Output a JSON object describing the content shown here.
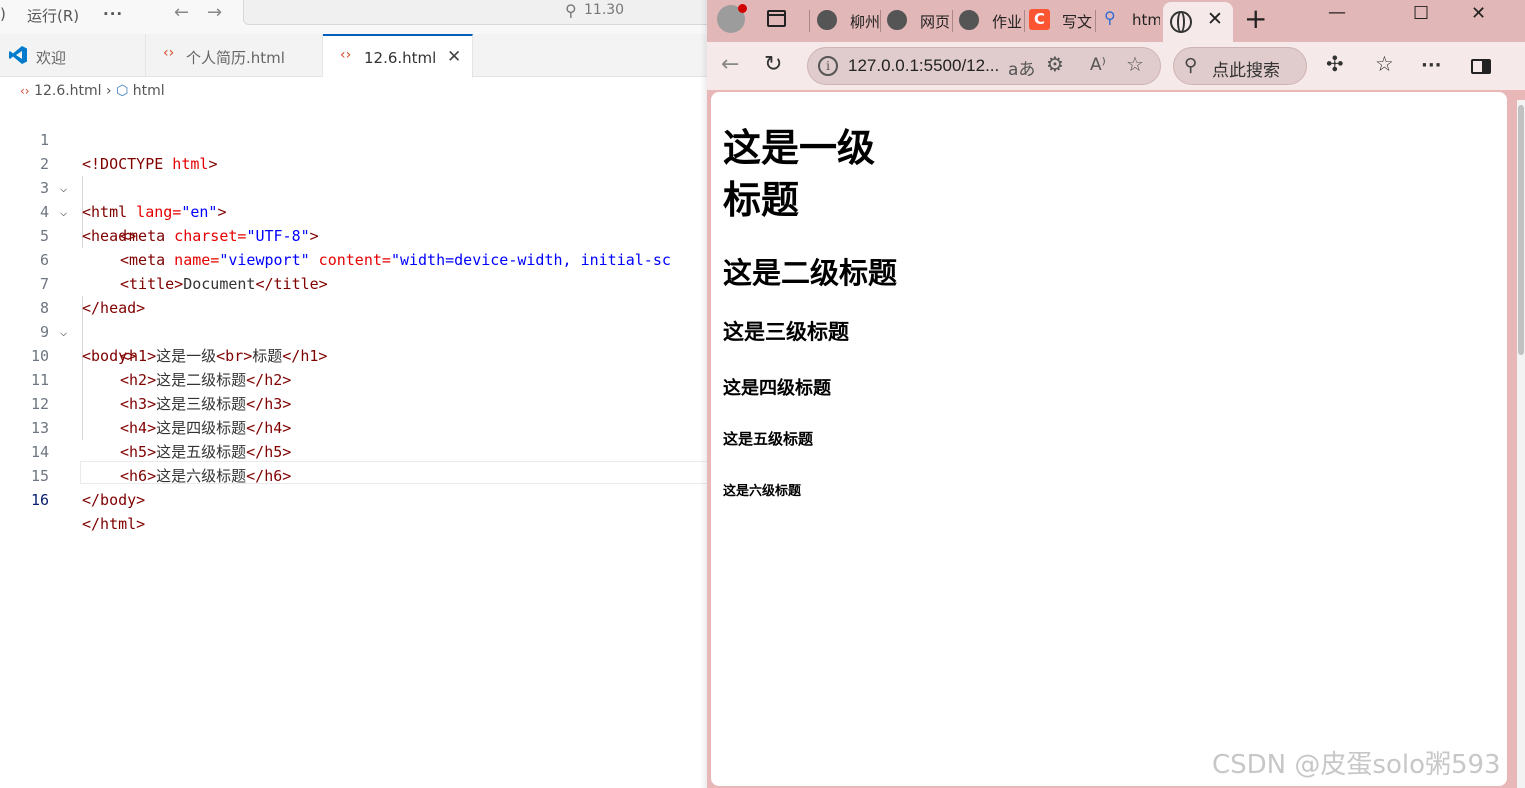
{
  "vscode": {
    "menu_partial": ")",
    "menu_run": "运行(R)",
    "menu_more": "···",
    "search_text": "11.30",
    "tabs": [
      {
        "label": "欢迎"
      },
      {
        "label": "个人简历.html"
      },
      {
        "label": "12.6.html",
        "close": "✕"
      }
    ],
    "breadcrumb": {
      "file": "12.6.html",
      "sep": "›",
      "symbol": "html"
    },
    "line_numbers": [
      "1",
      "2",
      "3",
      "4",
      "5",
      "6",
      "7",
      "8",
      "9",
      "10",
      "11",
      "12",
      "13",
      "14",
      "15",
      "16"
    ],
    "code": {
      "l1_tag": "<!DOCTYPE",
      "l1_attr": " html",
      "l1_end": ">",
      "l2_tag": "<html",
      "l2_attr": " lang=",
      "l2_val": "\"en\"",
      "l2_end": ">",
      "l3": "<head>",
      "l4_tag": "<meta",
      "l4_attr": " charset=",
      "l4_val": "\"UTF-8\"",
      "l4_end": ">",
      "l5_tag": "<meta",
      "l5_attr1": " name=",
      "l5_val1": "\"viewport\"",
      "l5_attr2": " content=",
      "l5_val2": "\"width=device-width, initial-sc",
      "l6_open": "<title>",
      "l6_text": "Document",
      "l6_close": "</title>",
      "l7": "</head>",
      "l8": "<body>",
      "l9_a": "<h1>",
      "l9_b": "这是一级",
      "l9_c": "<br>",
      "l9_d": "标题",
      "l9_e": "</h1>",
      "l10_a": "<h2>",
      "l10_b": "这是二级标题",
      "l10_c": "</h2>",
      "l11_a": "<h3>",
      "l11_b": "这是三级标题",
      "l11_c": "</h3>",
      "l12_a": "<h4>",
      "l12_b": "这是四级标题",
      "l12_c": "</h4>",
      "l13_a": "<h5>",
      "l13_b": "这是五级标题",
      "l13_c": "</h5>",
      "l14_a": "<h6>",
      "l14_b": "这是六级标题",
      "l14_c": "</h6>",
      "l15": "</body>",
      "l16": "</html>"
    }
  },
  "browser": {
    "tabs": [
      "柳州",
      "网页",
      "作业",
      "写文",
      "htm"
    ],
    "tab_c_badge": "C",
    "active_tab_close": "✕",
    "new_tab": "+",
    "window_controls": {
      "minimize": "—",
      "maximize": "☐",
      "close": "✕"
    },
    "address": "127.0.0.1:5500/12...",
    "address_read_aloud": "A⁾",
    "address_translate": "aあ",
    "search_placeholder": "点此搜索",
    "more": "···"
  },
  "page": {
    "h1_line1": "这是一级",
    "h1_line2": "标题",
    "h2": "这是二级标题",
    "h3": "这是三级标题",
    "h4": "这是四级标题",
    "h5": "这是五级标题",
    "h6": "这是六级标题"
  },
  "watermark": "CSDN @皮蛋solo粥593",
  "colors": {
    "browser_frame": "#e2b7b7",
    "vscode_accent": "#005fb8",
    "html_tag": "#800000",
    "html_attr": "#e50000",
    "html_value": "#0000ff"
  }
}
